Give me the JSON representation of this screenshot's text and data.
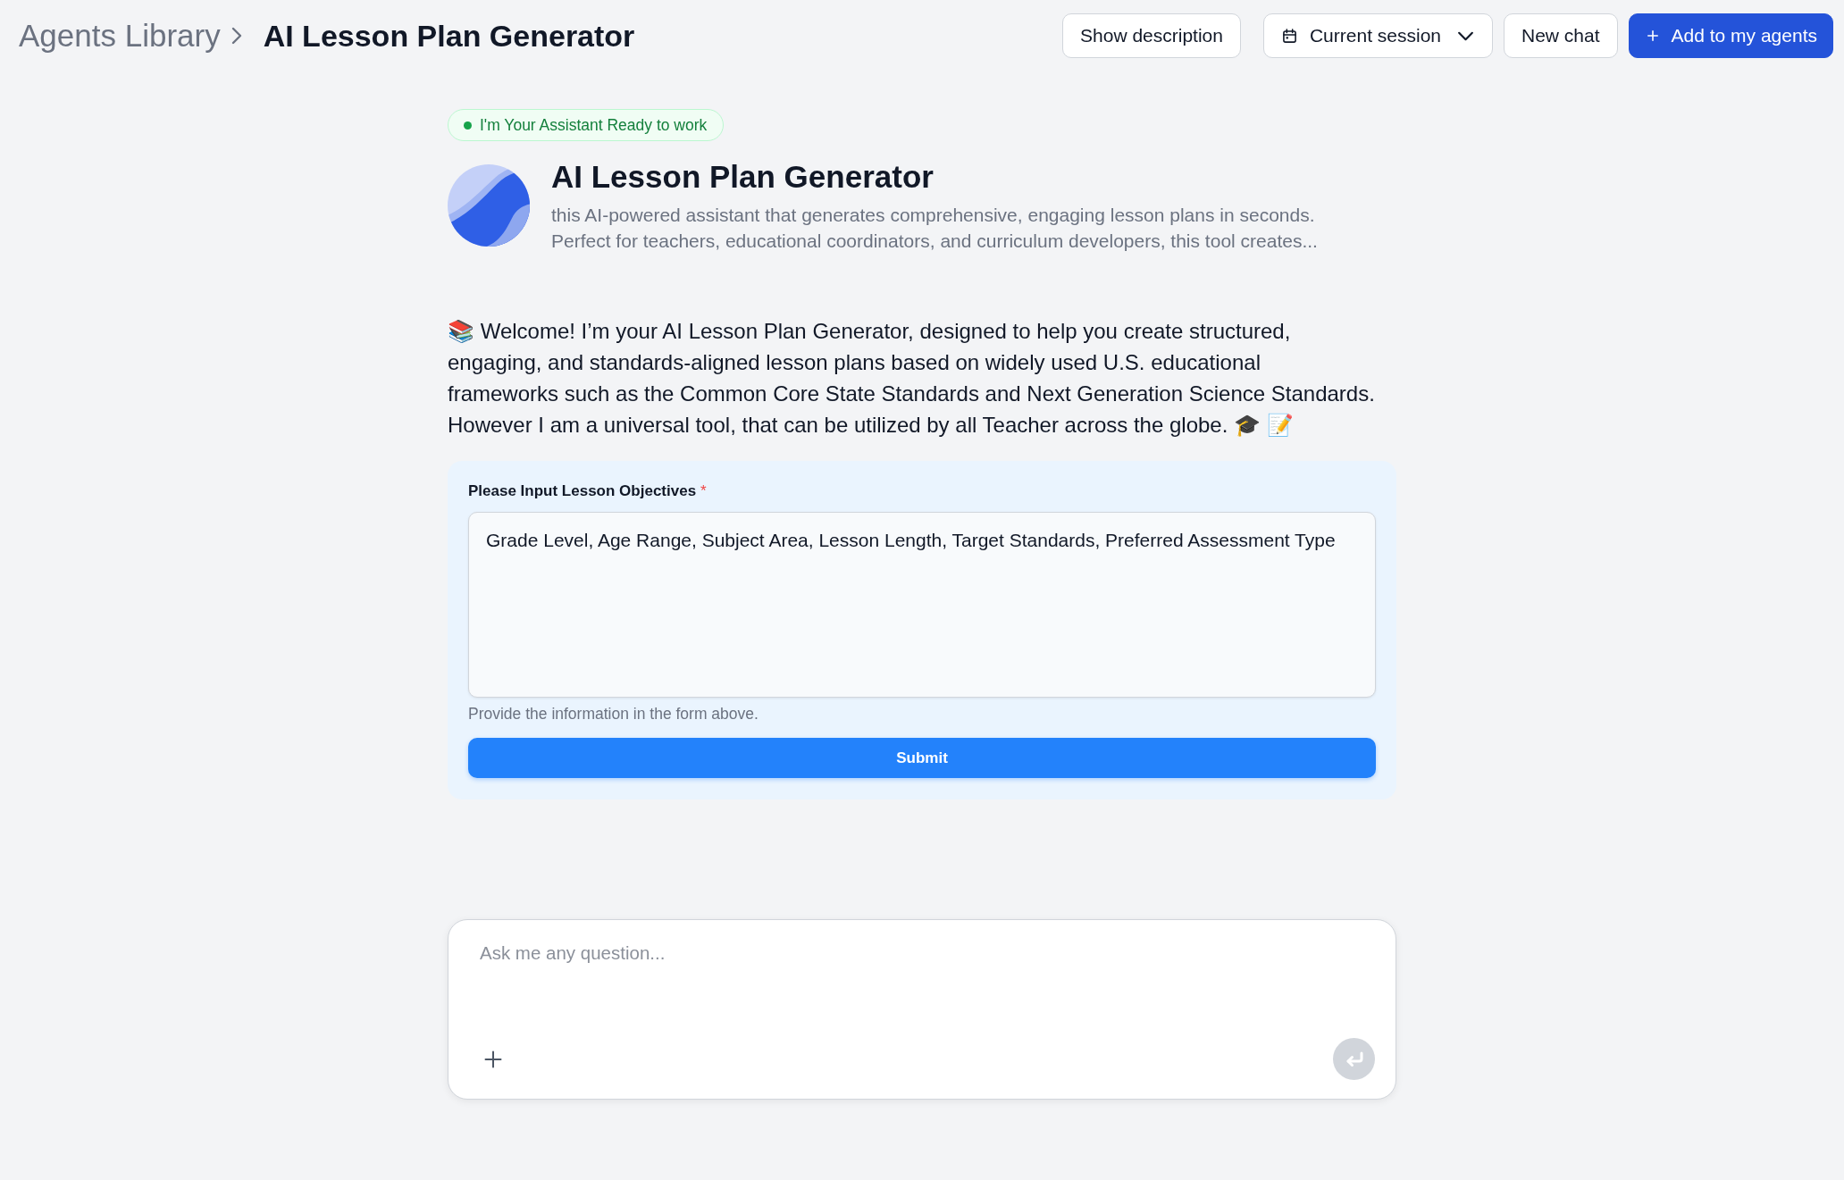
{
  "breadcrumb": [
    {
      "label": "Agents Library",
      "current": false
    },
    {
      "label": "AI Lesson Plan Generator",
      "current": true
    }
  ],
  "toolbar": [
    {
      "kind": "plain",
      "label": "Show description"
    },
    {
      "kind": "dropdown",
      "label": "Current session"
    },
    {
      "kind": "plain",
      "label": "New chat"
    },
    {
      "kind": "primary",
      "label": "Add to my agents"
    }
  ],
  "agent": {
    "status": "I'm Your Assistant Ready to work",
    "name": "AI Lesson Plan Generator",
    "description": "this AI-powered assistant that generates comprehensive, engaging lesson plans in seconds. Perfect for teachers, educational coordinators, and curriculum developers, this tool creates..."
  },
  "welcome_message": "📚 Welcome! I’m your AI Lesson Plan Generator, designed to help you create structured,\nengaging, and standards-aligned lesson plans based on widely used U.S. educational\nframeworks such as the Common Core State Standards and Next Generation Science Standards.\nHowever I am a universal tool, that can be utilized by all Teacher across the globe. 🎓 📝",
  "form": {
    "fields": [
      {
        "label": "Please Input Lesson Objectives",
        "required_mark": "*",
        "value": "Grade Level, Age Range, Subject Area, Lesson Length, Target Standards, Preferred Assessment Type",
        "help": "Provide the information in the form above."
      }
    ],
    "submit": "Submit"
  },
  "composer": {
    "placeholder": "Ask me any question...",
    "send_button": {
      "disabled": true
    }
  }
}
